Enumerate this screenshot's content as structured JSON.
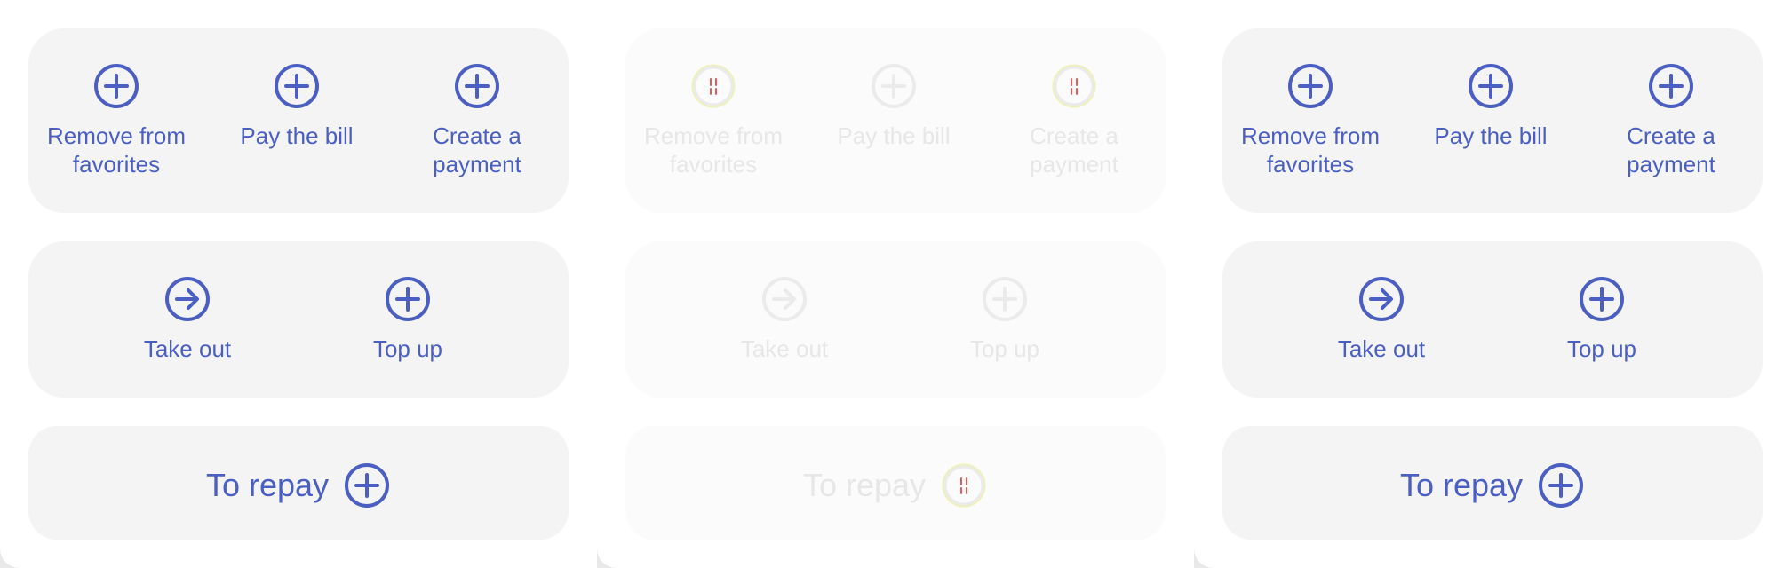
{
  "colors": {
    "accent": "#4a5fc1",
    "card_bg": "#f4f4f4",
    "disabled_text": "#e7e7e7",
    "disabled_icon": "#ebebeb",
    "loading_red": "#e85a5a",
    "loading_glow": "#e8eca0"
  },
  "columns": [
    {
      "state": "normal",
      "row3": [
        {
          "label": "Remove from favorites",
          "icon": "plus-circle-icon"
        },
        {
          "label": "Pay the bill",
          "icon": "plus-circle-icon"
        },
        {
          "label": "Create a payment",
          "icon": "plus-circle-icon"
        }
      ],
      "row2": [
        {
          "label": "Take out",
          "icon": "arrow-right-circle-icon"
        },
        {
          "label": "Top up",
          "icon": "plus-circle-icon"
        }
      ],
      "row1": {
        "label": "To repay",
        "icon": "plus-circle-icon"
      }
    },
    {
      "state": "disabled",
      "row3": [
        {
          "label": "Remove from favorites",
          "icon": "loading-icon"
        },
        {
          "label": "Pay the bill",
          "icon": "plus-circle-icon"
        },
        {
          "label": "Create a payment",
          "icon": "loading-icon"
        }
      ],
      "row2": [
        {
          "label": "Take out",
          "icon": "arrow-right-circle-icon"
        },
        {
          "label": "Top up",
          "icon": "plus-circle-icon"
        }
      ],
      "row1": {
        "label": "To repay",
        "icon": "loading-icon"
      }
    },
    {
      "state": "normal",
      "row3": [
        {
          "label": "Remove from favorites",
          "icon": "plus-circle-icon"
        },
        {
          "label": "Pay the bill",
          "icon": "plus-circle-icon"
        },
        {
          "label": "Create a payment",
          "icon": "plus-circle-icon"
        }
      ],
      "row2": [
        {
          "label": "Take out",
          "icon": "arrow-right-circle-icon"
        },
        {
          "label": "Top up",
          "icon": "plus-circle-icon"
        }
      ],
      "row1": {
        "label": "To repay",
        "icon": "plus-circle-icon"
      }
    }
  ]
}
